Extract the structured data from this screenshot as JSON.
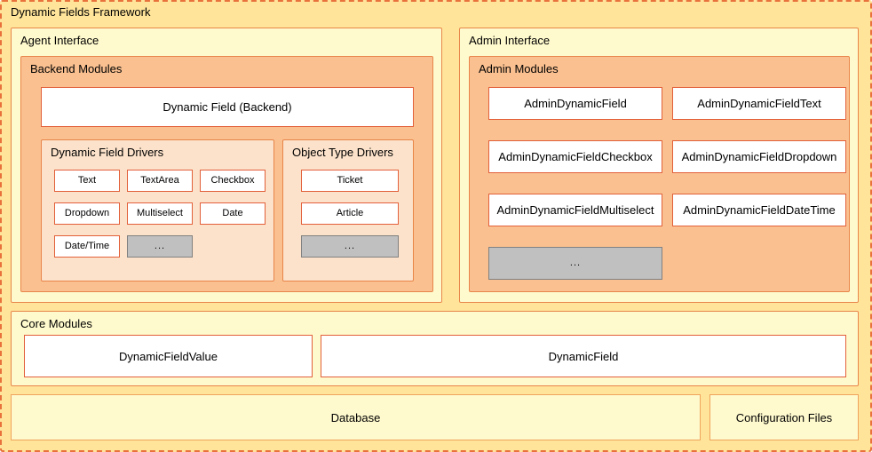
{
  "framework": {
    "title": "Dynamic Fields Framework"
  },
  "agent_interface": {
    "title": "Agent Interface",
    "backend_modules": {
      "title": "Backend Modules",
      "main_box": "Dynamic Field (Backend)",
      "dynamic_field_drivers": {
        "title": "Dynamic Field Drivers",
        "items": [
          "Text",
          "TextArea",
          "Checkbox",
          "Dropdown",
          "Multiselect",
          "Date",
          "Date/Time"
        ],
        "more": "..."
      },
      "object_type_drivers": {
        "title": "Object Type Drivers",
        "items": [
          "Ticket",
          "Article"
        ],
        "more": "..."
      }
    }
  },
  "admin_interface": {
    "title": "Admin Interface",
    "admin_modules": {
      "title": "Admin Modules",
      "items": [
        "AdminDynamicField",
        "AdminDynamicFieldText",
        "AdminDynamicFieldCheckbox",
        "AdminDynamicFieldDropdown",
        "AdminDynamicFieldMultiselect",
        "AdminDynamicFieldDateTime"
      ],
      "more": "..."
    }
  },
  "core_modules": {
    "title": "Core Modules",
    "items": [
      "DynamicFieldValue",
      "DynamicField"
    ]
  },
  "storage": {
    "database": "Database",
    "configuration_files": "Configuration Files"
  },
  "colors": {
    "framework_bg": "#ffe49a",
    "framework_border": "#e8713c",
    "panel_yellow": "#fffacd",
    "panel_orange": "#fac090",
    "panel_peach": "#fce2ca",
    "box_border": "#e2603a",
    "grey_box": "#c0c0c0"
  }
}
